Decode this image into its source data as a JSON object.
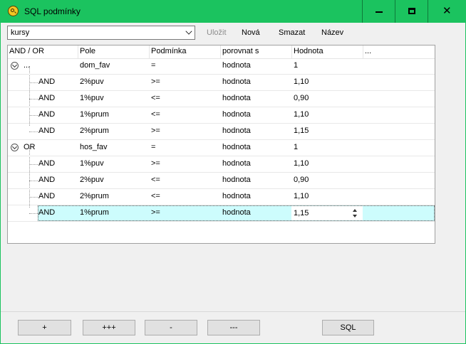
{
  "window": {
    "title": "SQL podmínky",
    "min_label": "—",
    "max_label": "▢",
    "close_label": "✕"
  },
  "toolbar": {
    "combo_value": "kursy",
    "save_label": "Uložit",
    "new_label": "Nová",
    "delete_label": "Smazat",
    "name_label": "Název"
  },
  "grid": {
    "columns": [
      "AND / OR",
      "Pole",
      "Podmínka",
      "porovnat s",
      "Hodnota",
      "..."
    ],
    "rows": [
      {
        "op": "...",
        "field": "dom_fav",
        "cond": "=",
        "compare": "hodnota",
        "value": "1",
        "group": true
      },
      {
        "op": "AND",
        "field": "2%puv",
        "cond": ">=",
        "compare": "hodnota",
        "value": "1,10"
      },
      {
        "op": "AND",
        "field": "1%puv",
        "cond": "<=",
        "compare": "hodnota",
        "value": "0,90"
      },
      {
        "op": "AND",
        "field": "1%prum",
        "cond": "<=",
        "compare": "hodnota",
        "value": "1,10"
      },
      {
        "op": "AND",
        "field": "2%prum",
        "cond": ">=",
        "compare": "hodnota",
        "value": "1,15"
      },
      {
        "op": "OR",
        "field": "hos_fav",
        "cond": "=",
        "compare": "hodnota",
        "value": "1",
        "group": true
      },
      {
        "op": "AND",
        "field": "1%puv",
        "cond": ">=",
        "compare": "hodnota",
        "value": "1,10"
      },
      {
        "op": "AND",
        "field": "2%puv",
        "cond": "<=",
        "compare": "hodnota",
        "value": "0,90"
      },
      {
        "op": "AND",
        "field": "2%prum",
        "cond": "<=",
        "compare": "hodnota",
        "value": "1,10"
      },
      {
        "op": "AND",
        "field": "1%prum",
        "cond": ">=",
        "compare": "hodnota",
        "value": "1,15",
        "selected": true
      }
    ]
  },
  "bottom": {
    "add_label": "+",
    "add_many_label": "+++",
    "remove_label": "-",
    "remove_many_label": "---",
    "sql_label": "SQL"
  },
  "colors": {
    "title_bar": "#1bc35f",
    "selected_row": "#cdfcfd"
  }
}
